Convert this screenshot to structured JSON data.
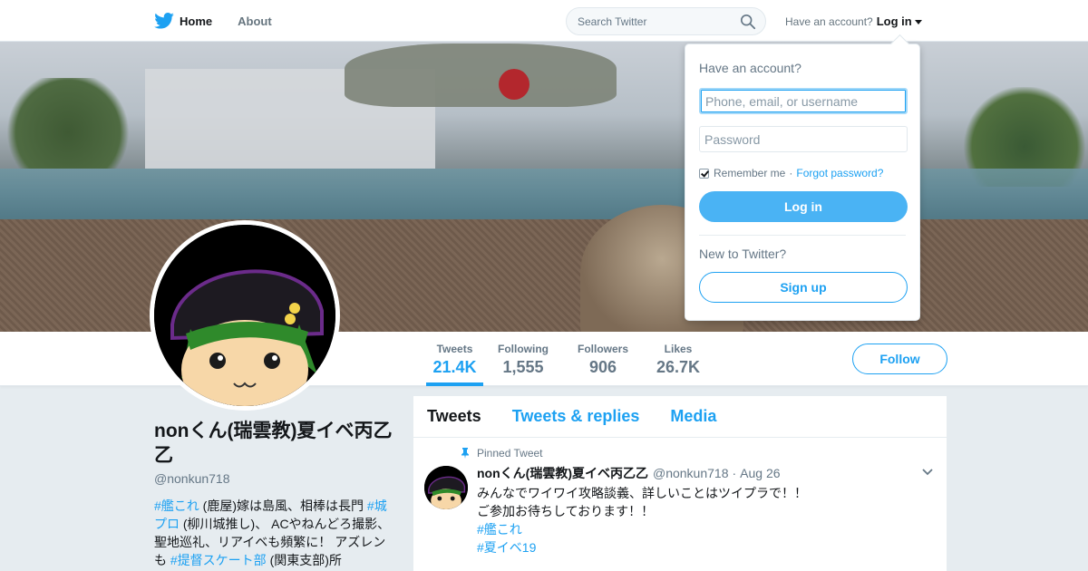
{
  "nav": {
    "home_label": "Home",
    "about_label": "About",
    "search_placeholder": "Search Twitter",
    "have_account": "Have an account?",
    "login_label": "Log in"
  },
  "profile_nav": {
    "stats": [
      {
        "label": "Tweets",
        "value": "21.4K"
      },
      {
        "label": "Following",
        "value": "1,555"
      },
      {
        "label": "Followers",
        "value": "906"
      },
      {
        "label": "Likes",
        "value": "26.7K"
      }
    ],
    "follow_label": "Follow"
  },
  "profile": {
    "name": "nonくん(瑞雲教)夏イベ丙乙乙",
    "handle": "@nonkun718",
    "bio": {
      "tag1": "#艦これ",
      "text1": " (鹿屋)嫁は島風、相棒は長門 ",
      "tag2": "#城プロ",
      "text2": " (柳川城推し)、 ACやねんどろ撮影、聖地巡礼、リアイベも頻繁に！ アズレンも ",
      "tag3": "#提督スケート部",
      "text3": " (関東支部)所"
    }
  },
  "timeline": {
    "tabs": [
      "Tweets",
      "Tweets & replies",
      "Media"
    ],
    "pinned_label": "Pinned Tweet",
    "tweet": {
      "name": "nonくん(瑞雲教)夏イベ丙乙乙",
      "handle": "@nonkun718",
      "dot": "·",
      "time": "Aug 26",
      "line1": "みんなでワイワイ攻略談義、詳しいことはツイプラで！！",
      "line2": "ご参加お待ちしております！！",
      "tag1": "#艦これ",
      "tag2": "#夏イベ19"
    }
  },
  "login_dropdown": {
    "title": "Have an account?",
    "username_placeholder": "Phone, email, or username",
    "password_placeholder": "Password",
    "remember_label": "Remember me",
    "separator": "·",
    "forgot_label": "Forgot password?",
    "login_button": "Log in",
    "new_label": "New to Twitter?",
    "signup_button": "Sign up"
  },
  "colors": {
    "brand": "#1da1f2",
    "text": "#14171a",
    "muted": "#657786",
    "background": "#e6ecf0"
  },
  "icons": [
    "twitter-bird-icon",
    "search-icon",
    "caret-down-icon",
    "pin-icon",
    "chevron-down-icon",
    "checkbox-checked-icon"
  ]
}
